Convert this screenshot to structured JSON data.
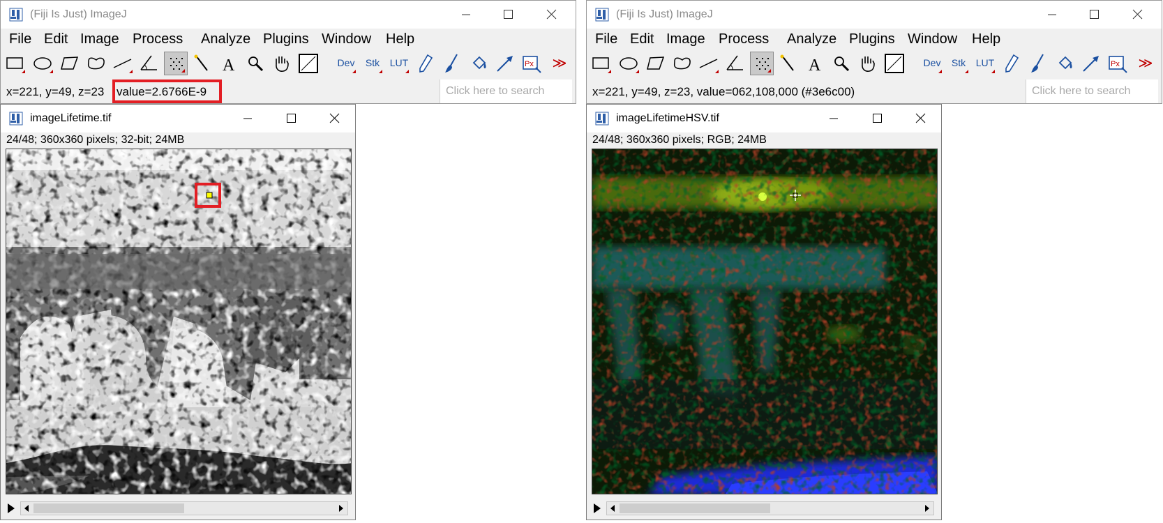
{
  "left_app": {
    "title": "(Fiji Is Just) ImageJ",
    "menu": [
      "File",
      "Edit",
      "Image",
      "Process",
      "Analyze",
      "Plugins",
      "Window",
      "Help"
    ],
    "status_prefix": "x=221, y=49, z=23",
    "status_value": "value=2.6766E-9",
    "search_placeholder": "Click here to search"
  },
  "right_app": {
    "title": "(Fiji Is Just) ImageJ",
    "menu": [
      "File",
      "Edit",
      "Image",
      "Process",
      "Analyze",
      "Plugins",
      "Window",
      "Help"
    ],
    "status_text": "x=221, y=49, z=23, value=062,108,000 (#3e6c00)",
    "search_placeholder": "Click here to search"
  },
  "toolbar": {
    "dev_label": "Dev",
    "stk_label": "Stk",
    "lut_label": "LUT",
    "more_label": "≫",
    "px_label": "Px",
    "icons": [
      "rectangle-tool-icon",
      "oval-tool-icon",
      "polygon-tool-icon",
      "freehand-tool-icon",
      "line-tool-icon",
      "angle-tool-icon",
      "point-tool-icon",
      "wand-tool-icon",
      "text-tool-icon",
      "magnifier-icon",
      "hand-icon",
      "color-picker-icon"
    ]
  },
  "left_image": {
    "title": "imageLifetime.tif",
    "info": "24/48; 360x360 pixels; 32-bit; 24MB",
    "scroll_position": 0.5
  },
  "right_image": {
    "title": "imageLifetimeHSV.tif",
    "info": "24/48; 360x360 pixels; RGB; 24MB",
    "scroll_position": 0.5
  },
  "colors": {
    "highlight": "#e31e24",
    "pixel_color": "#3e6c00",
    "title_gray": "#8a8a8a"
  }
}
